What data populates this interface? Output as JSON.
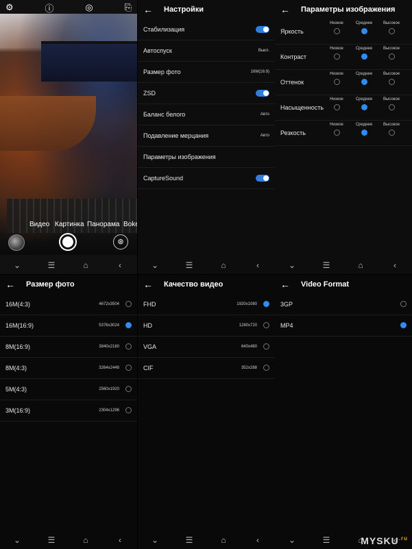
{
  "camera": {
    "top_icons": [
      "gear-icon",
      "flash-icon",
      "hdr-icon",
      "camera-switch-icon"
    ],
    "top_glyphs": [
      "⚙",
      "ⓘ",
      "◎",
      "⎘"
    ],
    "modes": [
      "Видео",
      "Картинка",
      "Панорама",
      "Boke"
    ],
    "effects_glyph": "⊛"
  },
  "settings": {
    "title": "Настройки",
    "rows": [
      {
        "label": "Стабилизация",
        "value": "",
        "toggle": true
      },
      {
        "label": "Автоспуск",
        "value": "Выкл.",
        "toggle": false
      },
      {
        "label": "Размер фото",
        "value": "16M(16:9)",
        "toggle": false
      },
      {
        "label": "ZSD",
        "value": "",
        "toggle": true
      },
      {
        "label": "Баланс белого",
        "value": "Авто",
        "toggle": false
      },
      {
        "label": "Подавление мерцания",
        "value": "Авто",
        "toggle": false
      },
      {
        "label": "Параметры изображения",
        "value": "",
        "toggle": false
      },
      {
        "label": "CaptureSound",
        "value": "",
        "toggle": true
      }
    ]
  },
  "image_params": {
    "title": "Параметры изображения",
    "options": [
      "Низкое",
      "Среднее",
      "Высокое"
    ],
    "rows": [
      {
        "label": "Яркость",
        "selected": 1
      },
      {
        "label": "Контраст",
        "selected": 1
      },
      {
        "label": "Оттенок",
        "selected": 1
      },
      {
        "label": "Насыщенность",
        "selected": 1
      },
      {
        "label": "Резкость",
        "selected": 1
      }
    ]
  },
  "photo_size": {
    "title": "Размер фото",
    "rows": [
      {
        "label": "16M(4:3)",
        "res": "4672x3504",
        "selected": false
      },
      {
        "label": "16M(16:9)",
        "res": "5376x3024",
        "selected": true
      },
      {
        "label": "8M(16:9)",
        "res": "3840x2160",
        "selected": false
      },
      {
        "label": "8M(4:3)",
        "res": "3264x2448",
        "selected": false
      },
      {
        "label": "5M(4:3)",
        "res": "2560x1920",
        "selected": false
      },
      {
        "label": "3M(16:9)",
        "res": "2304x1296",
        "selected": false
      }
    ]
  },
  "video_quality": {
    "title": "Качество видео",
    "rows": [
      {
        "label": "FHD",
        "res": "1920x1080",
        "selected": true
      },
      {
        "label": "HD",
        "res": "1280x720",
        "selected": false
      },
      {
        "label": "VGA",
        "res": "640x480",
        "selected": false
      },
      {
        "label": "CIF",
        "res": "352x288",
        "selected": false
      }
    ]
  },
  "video_format": {
    "title": "Video Format",
    "rows": [
      {
        "label": "3GP",
        "selected": false
      },
      {
        "label": "MP4",
        "selected": true
      }
    ]
  },
  "nav": {
    "icons": [
      "chevron-down-icon",
      "menu-icon",
      "home-icon",
      "back-icon"
    ],
    "glyphs": [
      "⌄",
      "☰",
      "⌂",
      "‹"
    ]
  },
  "back_glyph": "←",
  "watermark": {
    "text": "MYSKU",
    "suffix": ".ru"
  },
  "colors": {
    "accent": "#2f8cf0"
  }
}
